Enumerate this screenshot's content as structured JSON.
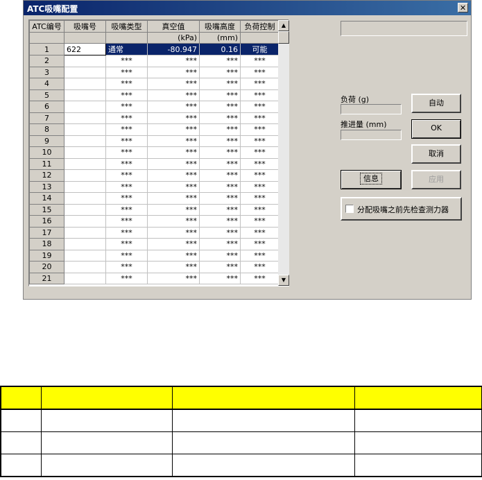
{
  "window": {
    "title": "ATC吸嘴配置",
    "close_glyph": "✕"
  },
  "grid": {
    "headers": [
      "ATC编号",
      "吸嘴号",
      "吸嘴类型",
      "真空值",
      "吸嘴高度",
      "负荷控制"
    ],
    "units": [
      "",
      "",
      "",
      "(kPa)",
      "(mm)",
      ""
    ],
    "selected_row": {
      "no": "1",
      "nozzle": "622",
      "type": "通常",
      "vacuum": "-80.947",
      "height": "0.16",
      "load": "可能"
    },
    "rows": [
      {
        "no": "2",
        "type": "***",
        "vacuum": "***",
        "height": "***",
        "load": "***"
      },
      {
        "no": "3",
        "type": "***",
        "vacuum": "***",
        "height": "***",
        "load": "***"
      },
      {
        "no": "4",
        "type": "***",
        "vacuum": "***",
        "height": "***",
        "load": "***"
      },
      {
        "no": "5",
        "type": "***",
        "vacuum": "***",
        "height": "***",
        "load": "***"
      },
      {
        "no": "6",
        "type": "***",
        "vacuum": "***",
        "height": "***",
        "load": "***"
      },
      {
        "no": "7",
        "type": "***",
        "vacuum": "***",
        "height": "***",
        "load": "***"
      },
      {
        "no": "8",
        "type": "***",
        "vacuum": "***",
        "height": "***",
        "load": "***"
      },
      {
        "no": "9",
        "type": "***",
        "vacuum": "***",
        "height": "***",
        "load": "***"
      },
      {
        "no": "10",
        "type": "***",
        "vacuum": "***",
        "height": "***",
        "load": "***"
      },
      {
        "no": "11",
        "type": "***",
        "vacuum": "***",
        "height": "***",
        "load": "***"
      },
      {
        "no": "12",
        "type": "***",
        "vacuum": "***",
        "height": "***",
        "load": "***"
      },
      {
        "no": "13",
        "type": "***",
        "vacuum": "***",
        "height": "***",
        "load": "***"
      },
      {
        "no": "14",
        "type": "***",
        "vacuum": "***",
        "height": "***",
        "load": "***"
      },
      {
        "no": "15",
        "type": "***",
        "vacuum": "***",
        "height": "***",
        "load": "***"
      },
      {
        "no": "16",
        "type": "***",
        "vacuum": "***",
        "height": "***",
        "load": "***"
      },
      {
        "no": "17",
        "type": "***",
        "vacuum": "***",
        "height": "***",
        "load": "***"
      },
      {
        "no": "18",
        "type": "***",
        "vacuum": "***",
        "height": "***",
        "load": "***"
      },
      {
        "no": "19",
        "type": "***",
        "vacuum": "***",
        "height": "***",
        "load": "***"
      },
      {
        "no": "20",
        "type": "***",
        "vacuum": "***",
        "height": "***",
        "load": "***"
      },
      {
        "no": "21",
        "type": "***",
        "vacuum": "***",
        "height": "***",
        "load": "***"
      }
    ]
  },
  "side": {
    "load_label": "负荷 (g)",
    "stroke_label": "推进量 (mm)",
    "auto_button": "自动",
    "ok_button": "OK",
    "cancel_button": "取消",
    "info_button": "信息",
    "apply_button": "应用",
    "check_label": "分配吸嘴之前先检查测力器"
  }
}
